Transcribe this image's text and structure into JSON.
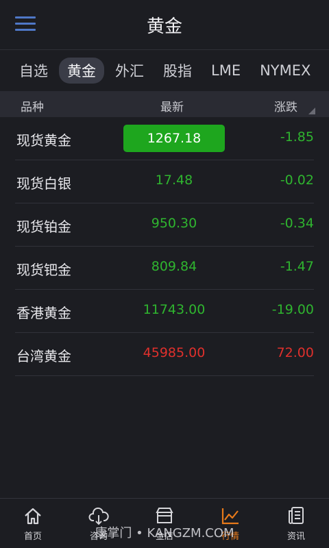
{
  "header": {
    "title": "黄金"
  },
  "tabs": [
    {
      "label": "自选",
      "active": false
    },
    {
      "label": "黄金",
      "active": true
    },
    {
      "label": "外汇",
      "active": false
    },
    {
      "label": "股指",
      "active": false
    },
    {
      "label": "LME",
      "active": false
    },
    {
      "label": "NYMEX",
      "active": false
    }
  ],
  "columns": {
    "name": "品种",
    "latest": "最新",
    "change": "涨跌"
  },
  "rows": [
    {
      "name": "现货黄金",
      "price": "1267.18",
      "change": "-1.85"
    },
    {
      "name": "现货白银",
      "price": "17.48",
      "change": "-0.02"
    },
    {
      "name": "现货铂金",
      "price": "950.30",
      "change": "-0.34"
    },
    {
      "name": "现货钯金",
      "price": "809.84",
      "change": "-1.47"
    },
    {
      "name": "香港黄金",
      "price": "11743.00",
      "change": "-19.00"
    },
    {
      "name": "台湾黄金",
      "price": "45985.00",
      "change": "72.00"
    }
  ],
  "bottom_nav": [
    {
      "label": "首页",
      "icon": "home-icon"
    },
    {
      "label": "咨询",
      "icon": "cloud-icon"
    },
    {
      "label": "金店",
      "icon": "store-icon"
    },
    {
      "label": "行情",
      "icon": "chart-icon",
      "active": true
    },
    {
      "label": "资讯",
      "icon": "news-icon"
    }
  ],
  "watermark": "康掌门 • KANGZM.COM",
  "colors": {
    "up": "#e0302c",
    "down": "#2fb52f",
    "accent": "#e87a1a",
    "highlight": "#1ea61e"
  }
}
